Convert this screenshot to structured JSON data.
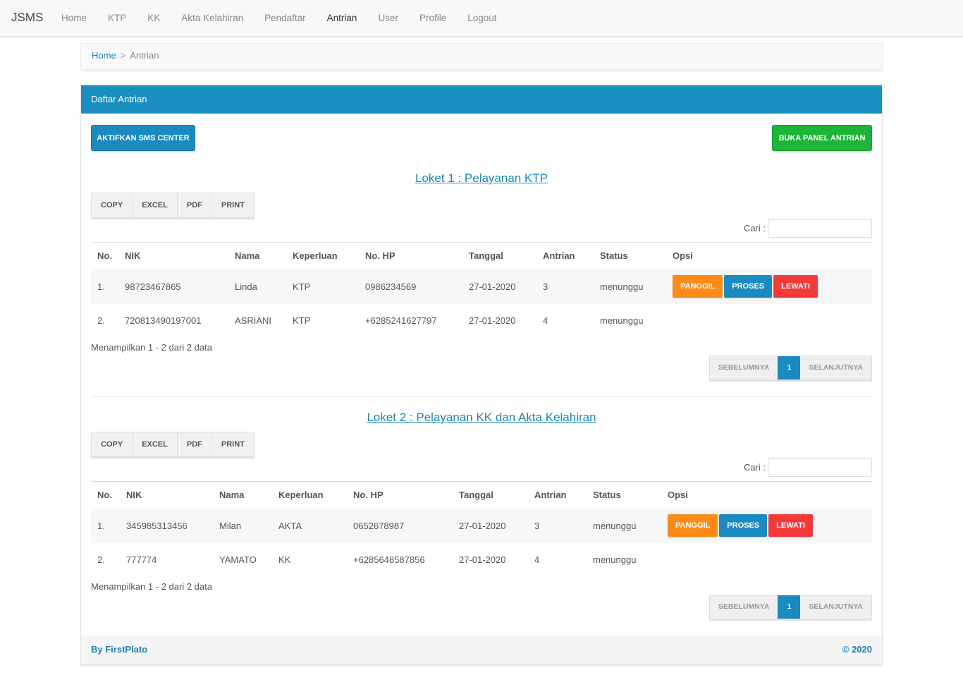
{
  "app": {
    "brand": "JSMS"
  },
  "nav": [
    {
      "label": "Home"
    },
    {
      "label": "KTP"
    },
    {
      "label": "KK"
    },
    {
      "label": "Akta Kelahiran"
    },
    {
      "label": "Pendaftar"
    },
    {
      "label": "Antrian"
    },
    {
      "label": "User"
    },
    {
      "label": "Profile"
    },
    {
      "label": "Logout"
    }
  ],
  "breadcrumb": {
    "home": "Home",
    "sep": ">",
    "current": "Antrian"
  },
  "panel": {
    "title": "Daftar Antrian",
    "sms_button": "AKTIFKAN SMS CENTER",
    "queue_button": "BUKA PANEL ANTRIAN",
    "footer_left": "By FirstPlato",
    "footer_right": "© 2020"
  },
  "common": {
    "tools": [
      "COPY",
      "EXCEL",
      "PDF",
      "PRINT"
    ],
    "search_label": "Cari :",
    "columns": [
      "No.",
      "NIK",
      "Nama",
      "Keperluan",
      "No. HP",
      "Tanggal",
      "Antrian",
      "Status",
      "Opsi"
    ],
    "actions": [
      "PANGGIL",
      "PROSES",
      "LEWATI"
    ],
    "prev": "SEBELUMNYA",
    "page": "1",
    "next": "SELANJUTNYA"
  },
  "loket": [
    {
      "title": "Loket 1 : Pelayanan KTP",
      "info": "Menampilkan 1 - 2 dari 2 data",
      "rows": [
        {
          "no": "1.",
          "nik": "98723467865",
          "nama": "Linda",
          "keperluan": "KTP",
          "hp": "0986234569",
          "tanggal": "27-01-2020",
          "antrian": "3",
          "status": "menunggu"
        },
        {
          "no": "2.",
          "nik": "720813490197001",
          "nama": "ASRIANI",
          "keperluan": "KTP",
          "hp": "+6285241627797",
          "tanggal": "27-01-2020",
          "antrian": "4",
          "status": "menunggu"
        }
      ]
    },
    {
      "title": "Loket 2 : Pelayanan KK dan Akta Kelahiran",
      "info": "Menampilkan 1 - 2 dari 2 data",
      "rows": [
        {
          "no": "1.",
          "nik": "345985313456",
          "nama": "Milan",
          "keperluan": "AKTA",
          "hp": "0652678987",
          "tanggal": "27-01-2020",
          "antrian": "3",
          "status": "menunggu"
        },
        {
          "no": "2.",
          "nik": "777774",
          "nama": "YAMATO",
          "keperluan": "KK",
          "hp": "+6285648587856",
          "tanggal": "27-01-2020",
          "antrian": "4",
          "status": "menunggu"
        }
      ]
    }
  ]
}
